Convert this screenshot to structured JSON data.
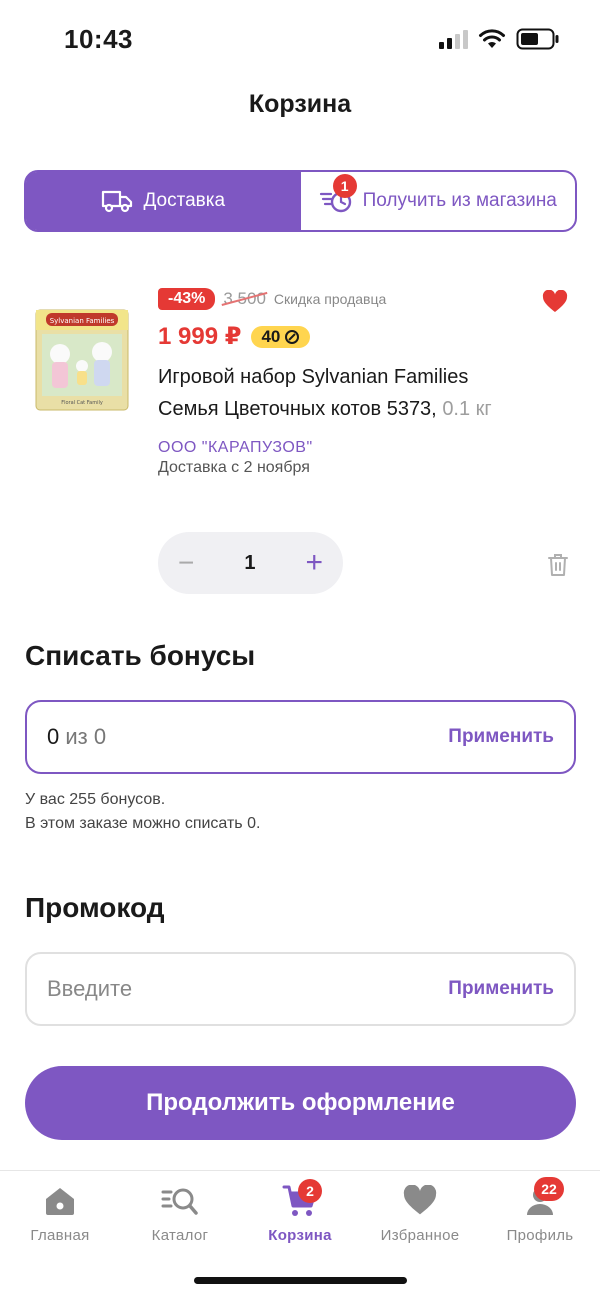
{
  "status": {
    "time": "10:43"
  },
  "page": {
    "title": "Корзина"
  },
  "delivery_toggle": {
    "delivery_label": "Доставка",
    "pickup_label": "Получить из магазина",
    "pickup_badge": "1"
  },
  "product": {
    "discount": "-43%",
    "old_price": "3 500",
    "seller_discount": "Скидка продавца",
    "price": "1 999 ₽",
    "bonus": "40",
    "name": "Игровой набор Sylvanian Families Семья Цветочных котов 5373,",
    "weight": "0.1 кг",
    "seller": "ООО \"КАРАПУЗОВ\"",
    "delivery": "Доставка с 2 ноября",
    "quantity": "1",
    "image_label": "Sylvanian Families",
    "image_caption": "Floral Cat Family"
  },
  "bonuses": {
    "title": "Списать бонусы",
    "value": "0",
    "of_total": "из 0",
    "apply": "Применить",
    "note_line1": "У вас 255 бонусов.",
    "note_line2": "В этом заказе можно списать 0."
  },
  "promo": {
    "title": "Промокод",
    "placeholder": "Введите",
    "apply": "Применить"
  },
  "cta": {
    "label": "Продолжить оформление"
  },
  "tabs": [
    {
      "label": "Главная",
      "icon": "home-icon"
    },
    {
      "label": "Каталог",
      "icon": "catalog-search-icon"
    },
    {
      "label": "Корзина",
      "icon": "cart-icon",
      "badge": "2"
    },
    {
      "label": "Избранное",
      "icon": "heart-icon"
    },
    {
      "label": "Профиль",
      "icon": "profile-icon",
      "badge": "22"
    }
  ],
  "colors": {
    "accent": "#7e57c2",
    "danger": "#e53935",
    "bonus": "#ffd54f"
  }
}
